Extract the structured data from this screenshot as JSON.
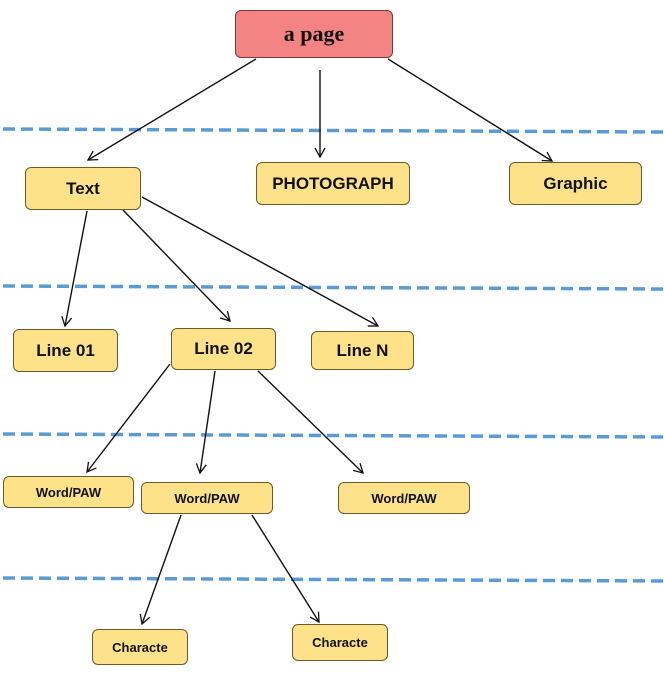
{
  "colors": {
    "root": "#f48484",
    "node": "#fde28a",
    "separator": "#5b9bd5",
    "edge": "#111111"
  },
  "nodes": {
    "root": "a page",
    "text": "Text",
    "photograph": "PHOTOGRAPH",
    "graphic": "Graphic",
    "line01": "Line 01",
    "line02": "Line 02",
    "lineN": "Line N",
    "word1": "Word/PAW",
    "word2": "Word/PAW",
    "word3": "Word/PAW",
    "char1": "Characte",
    "char2": "Characte"
  },
  "edges": [
    [
      "root",
      "text"
    ],
    [
      "root",
      "photograph"
    ],
    [
      "root",
      "graphic"
    ],
    [
      "text",
      "line01"
    ],
    [
      "text",
      "line02"
    ],
    [
      "text",
      "lineN"
    ],
    [
      "line02",
      "word1"
    ],
    [
      "line02",
      "word2"
    ],
    [
      "line02",
      "word3"
    ],
    [
      "word2",
      "char1"
    ],
    [
      "word2",
      "char2"
    ]
  ]
}
